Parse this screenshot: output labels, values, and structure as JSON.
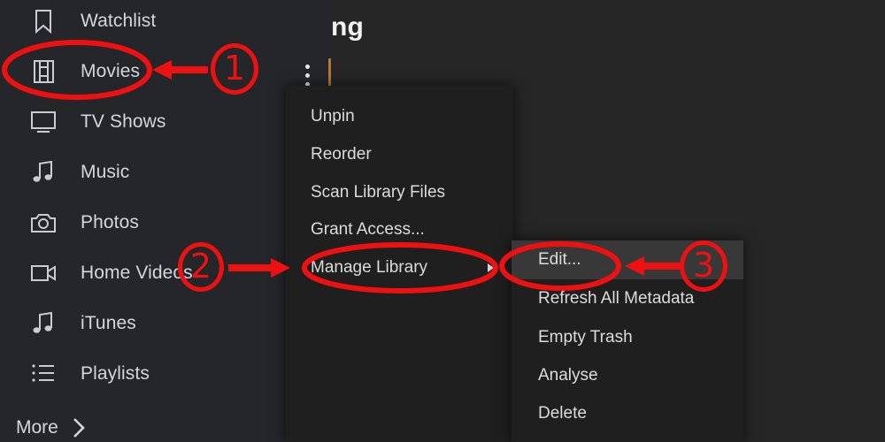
{
  "app": {
    "header_title_fragment": "ng",
    "background_color": "#262626",
    "sidebar_color": "#252629",
    "menu_color": "#1f1f1f",
    "menu_highlight_color": "#383838",
    "accent_color": "#b5783a",
    "annotation_color": "#ee1111"
  },
  "sidebar": {
    "items": [
      {
        "label": "Watchlist",
        "icon": "bookmark-icon"
      },
      {
        "label": "Movies",
        "icon": "film-strip-icon"
      },
      {
        "label": "TV Shows",
        "icon": "television-icon"
      },
      {
        "label": "Music",
        "icon": "music-note-icon"
      },
      {
        "label": "Photos",
        "icon": "camera-icon"
      },
      {
        "label": "Home Videos",
        "icon": "video-camera-icon"
      },
      {
        "label": "iTunes",
        "icon": "music-note-icon"
      },
      {
        "label": "Playlists",
        "icon": "list-icon"
      }
    ],
    "more": {
      "label": "More",
      "icon": "chevron-right-icon"
    }
  },
  "context_menu": {
    "items": [
      {
        "label": "Unpin",
        "submenu": false
      },
      {
        "label": "Reorder",
        "submenu": false
      },
      {
        "label": "Scan Library Files",
        "submenu": false
      },
      {
        "label": "Grant Access...",
        "submenu": false
      },
      {
        "label": "Manage Library",
        "submenu": true
      }
    ]
  },
  "submenu": {
    "items": [
      {
        "label": "Edit...",
        "selected": true
      },
      {
        "label": "Refresh All Metadata",
        "selected": false
      },
      {
        "label": "Empty Trash",
        "selected": false
      },
      {
        "label": "Analyse",
        "selected": false
      },
      {
        "label": "Delete",
        "selected": false
      }
    ]
  },
  "annotations": [
    {
      "number": "1",
      "target": "Movies"
    },
    {
      "number": "2",
      "target": "Manage Library"
    },
    {
      "number": "3",
      "target": "Edit..."
    }
  ]
}
